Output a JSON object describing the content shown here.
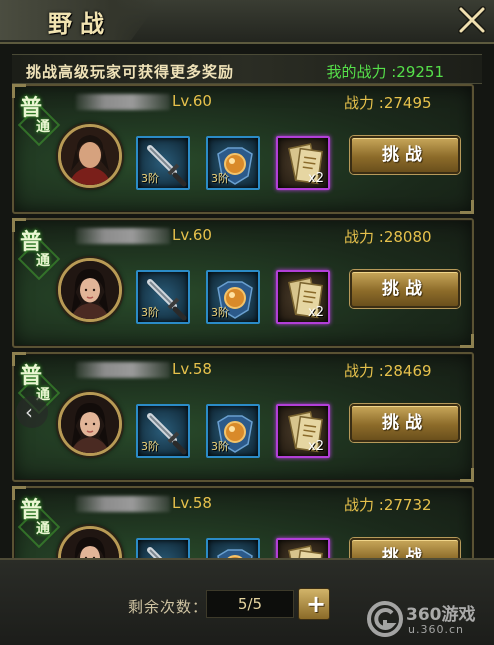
{
  "header": {
    "title": "野战",
    "close_icon": "close-x-icon"
  },
  "subheader": {
    "tip": "挑战高级玩家可获得更多奖励",
    "my_power": "我的战力 :29251"
  },
  "opponents": [
    {
      "rank": [
        "普",
        "通"
      ],
      "level": "Lv.60",
      "power": "战力 :27495",
      "gender": "male",
      "items": [
        {
          "icon": "sword-icon",
          "tier": "3阶"
        },
        {
          "icon": "armor-orb-icon",
          "tier": "3阶"
        },
        {
          "icon": "scroll-icon",
          "qty": "x2"
        }
      ],
      "button": "挑战"
    },
    {
      "rank": [
        "普",
        "通"
      ],
      "level": "Lv.60",
      "power": "战力 :28080",
      "gender": "female",
      "items": [
        {
          "icon": "sword-icon",
          "tier": "3阶"
        },
        {
          "icon": "armor-orb-icon",
          "tier": "3阶"
        },
        {
          "icon": "scroll-icon",
          "qty": "x2"
        }
      ],
      "button": "挑战"
    },
    {
      "rank": [
        "普",
        "通"
      ],
      "level": "Lv.58",
      "power": "战力 :28469",
      "gender": "female",
      "items": [
        {
          "icon": "sword-icon",
          "tier": "3阶"
        },
        {
          "icon": "armor-orb-icon",
          "tier": "3阶"
        },
        {
          "icon": "scroll-icon",
          "qty": "x2"
        }
      ],
      "button": "挑战"
    },
    {
      "rank": [
        "普",
        "通"
      ],
      "level": "Lv.58",
      "power": "战力 :27732",
      "gender": "female",
      "items": [
        {
          "icon": "sword-icon",
          "tier": ""
        },
        {
          "icon": "armor-orb-icon",
          "tier": ""
        },
        {
          "icon": "scroll-icon",
          "qty": ""
        }
      ],
      "button": "挑战"
    }
  ],
  "footer": {
    "remain_label": "剩余次数：",
    "remain_value": "5/5",
    "plus_icon": "plus-icon"
  },
  "watermark": {
    "text": "360游戏",
    "url": "u.360.cn"
  },
  "colors": {
    "accent_gold": "#e6c14c",
    "power_green": "#56e04a",
    "item_blue": "#2b8bc7",
    "item_purple": "#b23fd8"
  }
}
